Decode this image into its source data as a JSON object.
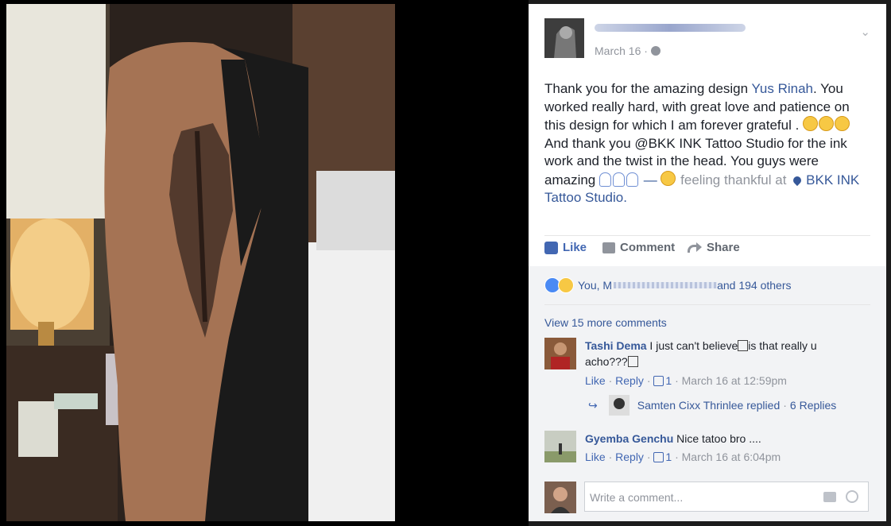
{
  "post": {
    "time": "March 16",
    "text": {
      "p1": "Thank you for the amazing design ",
      "mention": "Yus Rinah",
      "p2": ". You worked really hard, with great love and patience on this design for which I am forever grateful . ",
      "p3": "And thank you @BKK INK Tattoo Studio for the ink work and the twist in the head. You guys were amazing ",
      "feeling": " — ",
      "feeling_text": " feeling thankful at ",
      "place": "BKK INK Tattoo Studio",
      "end": "."
    }
  },
  "actions": {
    "like": "Like",
    "comment": "Comment",
    "share": "Share"
  },
  "reactions": {
    "prefix": "You, M",
    "suffix": "and 194 others"
  },
  "view_more": "View 15 more comments",
  "comments": [
    {
      "name": "Tashi Dema",
      "text1": " I just can't believe",
      "text2": "is that really u acho???",
      "like": "Like",
      "reply": "Reply",
      "likes": "1",
      "time": "March 16 at 12:59pm",
      "replies": {
        "name": "Samten Cixx Thrinlee replied",
        "count": "6 Replies"
      }
    },
    {
      "name": "Gyemba Genchu",
      "text1": " Nice tatoo bro ....",
      "like": "Like",
      "reply": "Reply",
      "likes": "1",
      "time": "March 16 at 6:04pm"
    }
  ],
  "write_placeholder": "Write a comment...",
  "colors": {
    "link": "#365899",
    "muted": "#90949c",
    "bg": "#f2f3f5"
  }
}
